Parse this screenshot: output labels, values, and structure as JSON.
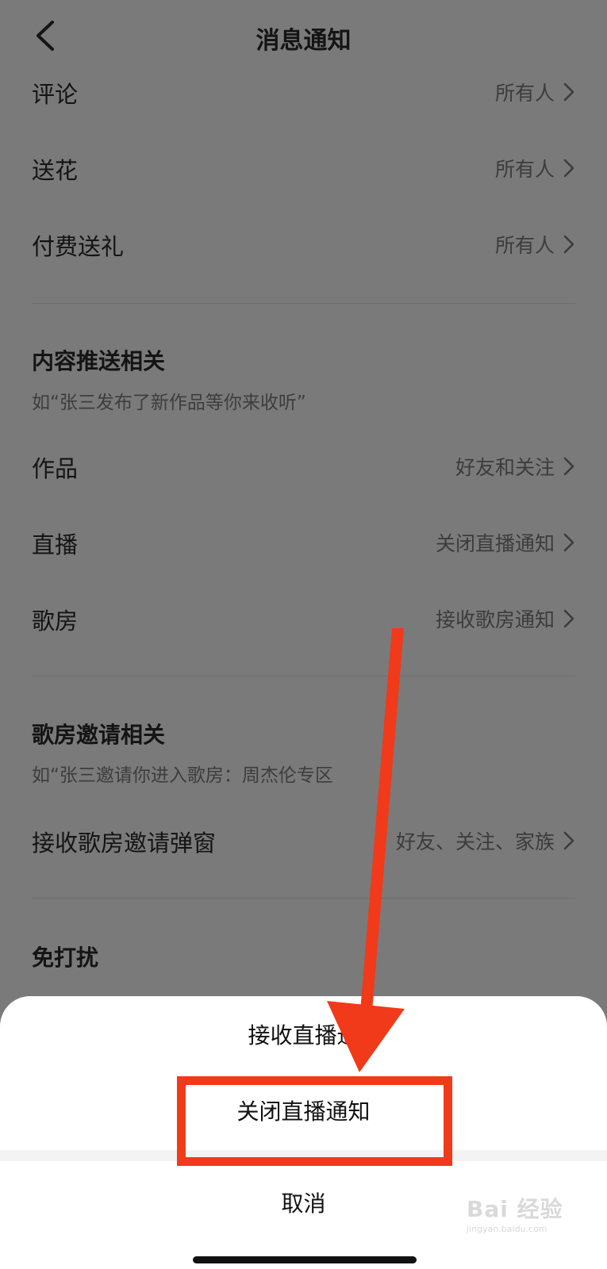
{
  "nav": {
    "title": "消息通知"
  },
  "interaction_rows": [
    {
      "label": "评论",
      "value": "所有人"
    },
    {
      "label": "送花",
      "value": "所有人"
    },
    {
      "label": "付费送礼",
      "value": "所有人"
    }
  ],
  "content_push": {
    "title": "内容推送相关",
    "subtitle": "如“张三发布了新作品等你来收听”",
    "rows": [
      {
        "label": "作品",
        "value": "好友和关注"
      },
      {
        "label": "直播",
        "value": "关闭直播通知"
      },
      {
        "label": "歌房",
        "value": "接收歌房通知"
      }
    ]
  },
  "room_invite": {
    "title": "歌房邀请相关",
    "subtitle": "如“张三邀请你进入歌房：周杰伦专区",
    "rows": [
      {
        "label": "接收歌房邀请弹窗",
        "value": "好友、关注、家族"
      }
    ]
  },
  "dnd": {
    "title": "免打扰"
  },
  "sheet": {
    "options": [
      "接收直播通",
      "关闭直播通知"
    ],
    "cancel": "取消"
  },
  "annotation": {
    "arrow_color": "#f03a1a",
    "box_color": "#f03a1a"
  },
  "watermark": {
    "text": "Bai 经验",
    "url": "jingyan.baidu.com"
  },
  "icons": {
    "back": "chevron-left-icon",
    "row_arrow": "chevron-right-icon"
  }
}
